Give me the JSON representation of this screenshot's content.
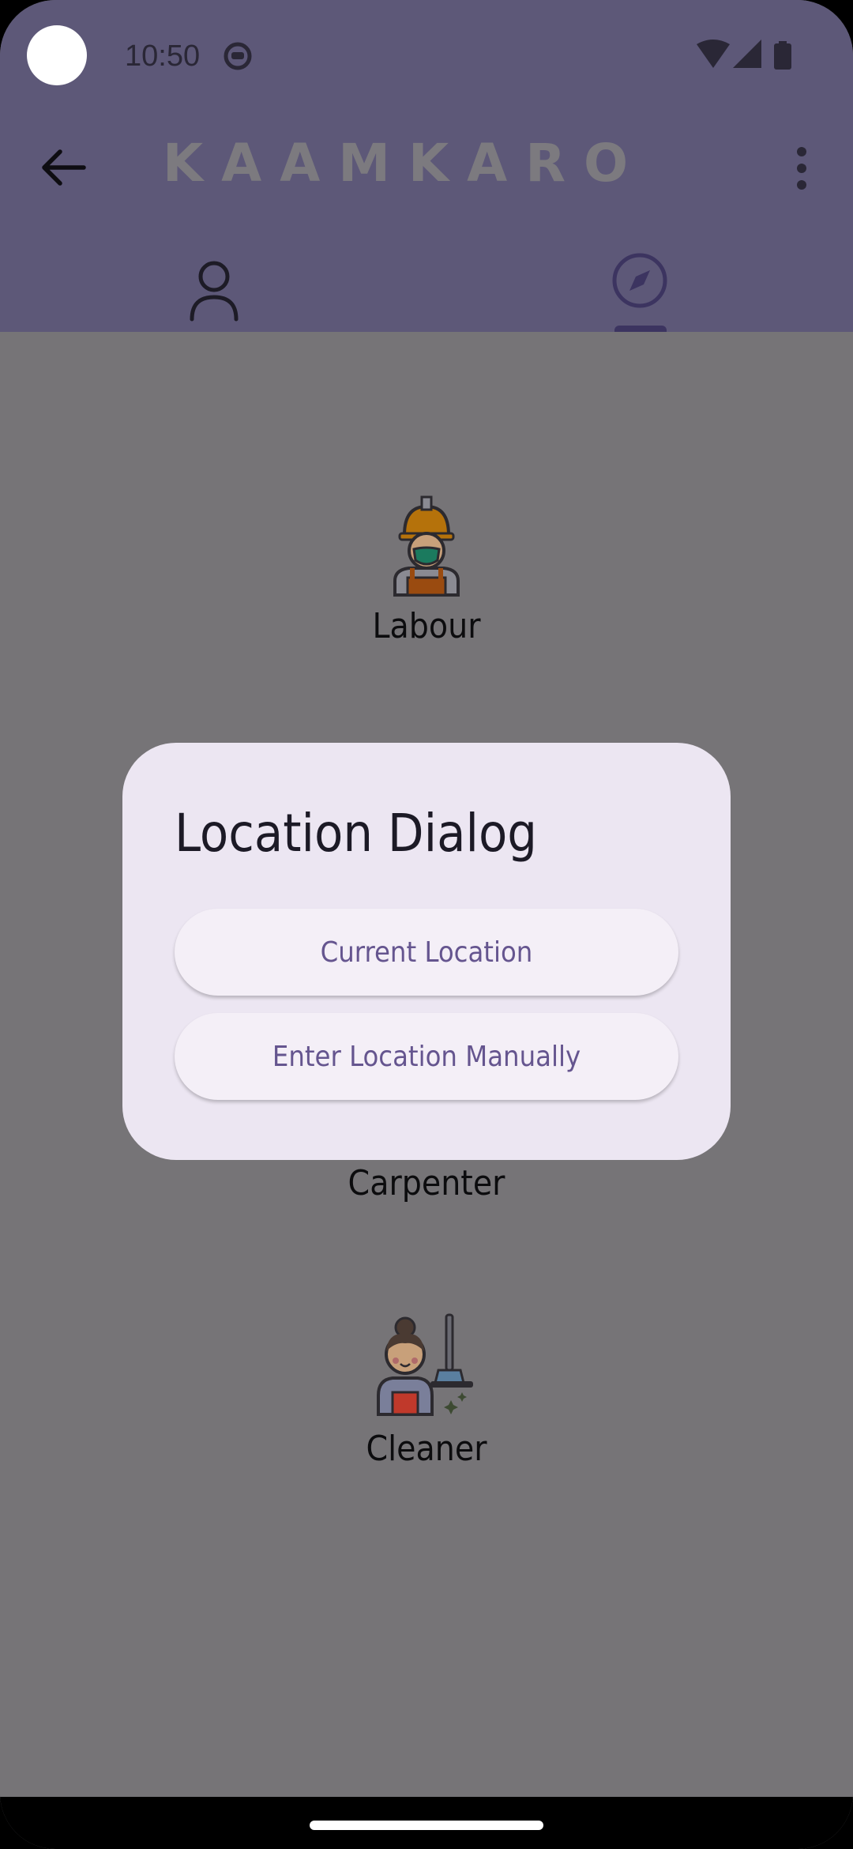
{
  "status_bar": {
    "time": "10:50"
  },
  "app_bar": {
    "title": "KAAMKARO"
  },
  "tabs": [
    {
      "name": "profile",
      "icon": "person-icon",
      "selected": false
    },
    {
      "name": "explore",
      "icon": "compass-icon",
      "selected": true
    }
  ],
  "services": [
    {
      "label": "Labour",
      "icon": "labour-worker-icon"
    },
    {
      "label": "Carpenter",
      "icon": "carpenter-icon"
    },
    {
      "label": "Cleaner",
      "icon": "cleaner-icon"
    }
  ],
  "dialog": {
    "title": "Location Dialog",
    "current_location": "Current Location",
    "manual_location": "Enter Location Manually"
  },
  "colors": {
    "app_bar": "#5d5878",
    "scrim": "#767477",
    "dialog_bg": "#ece6f2",
    "button_text": "#65558f"
  }
}
